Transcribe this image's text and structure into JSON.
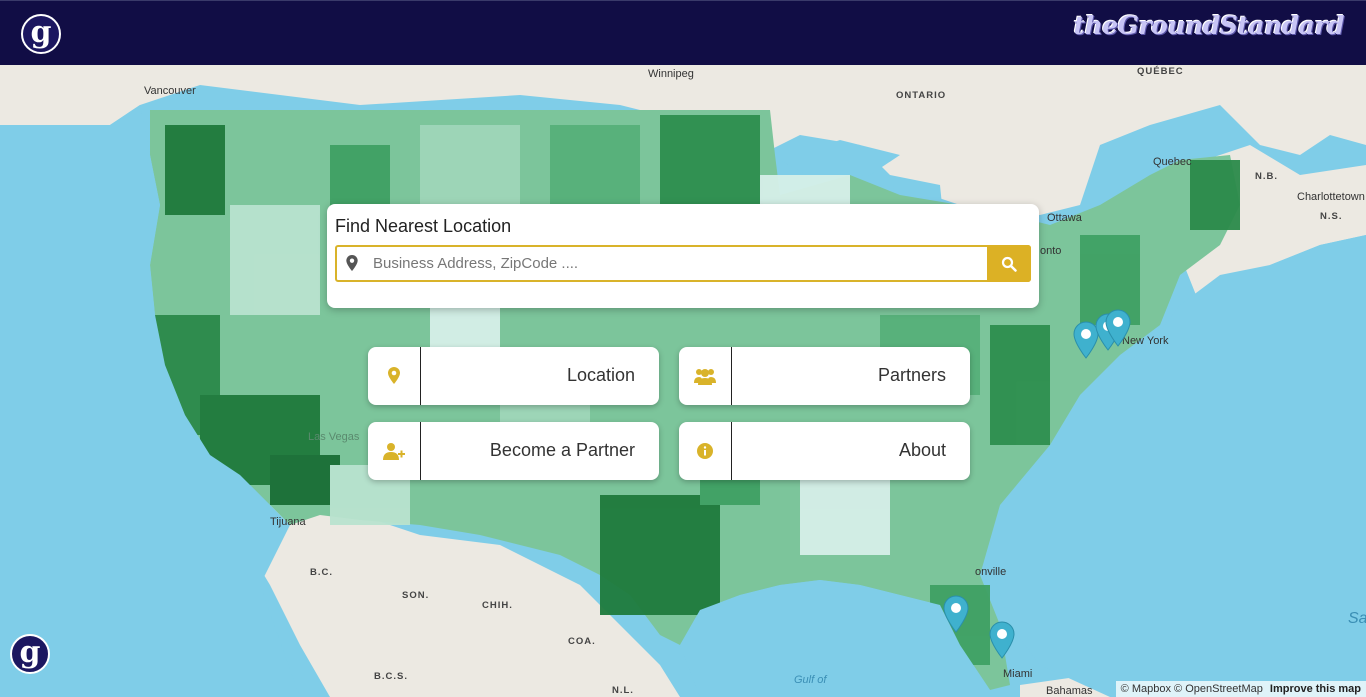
{
  "header": {
    "logo_letter": "g",
    "brand_text": "theGroundStandard"
  },
  "search": {
    "title": "Find Nearest Location",
    "placeholder": "Business Address, ZipCode ...."
  },
  "nav": {
    "location_label": "Location",
    "partners_label": "Partners",
    "become_partner_label": "Become a Partner",
    "about_label": "About"
  },
  "map_labels": {
    "vancouver": "Vancouver",
    "winnipeg": "Winnipeg",
    "ontario": "ONTARIO",
    "quebec_prov": "QUÉBEC",
    "quebec_city": "Quebec",
    "nb": "N.B.",
    "charlottetown": "Charlottetown",
    "ns": "N.S.",
    "ottawa": "Ottawa",
    "toronto": "onto",
    "new_york": "New York",
    "las_vegas": "Las Vegas",
    "tijuana": "Tijuana",
    "bc": "B.C.",
    "son": "SON.",
    "chih": "CHIH.",
    "coa": "COA.",
    "bcs": "B.C.S.",
    "nl": "N.L.",
    "gulf": "Gulf of",
    "jacksonville": "onville",
    "miami": "Miami",
    "bahamas": "Bahamas",
    "sa": "Sa"
  },
  "attribution": {
    "mapbox": "© Mapbox",
    "osm": "© OpenStreetMap",
    "improve": "Improve this map"
  },
  "colors": {
    "header_bg": "#110d45",
    "accent_gold": "#dcb125",
    "marker_blue": "#3fb1ce",
    "water": "#7fcde8",
    "land": "#eae7e0",
    "choropleth_dark": "#1f7a3c",
    "choropleth_light": "#d6efe8"
  }
}
